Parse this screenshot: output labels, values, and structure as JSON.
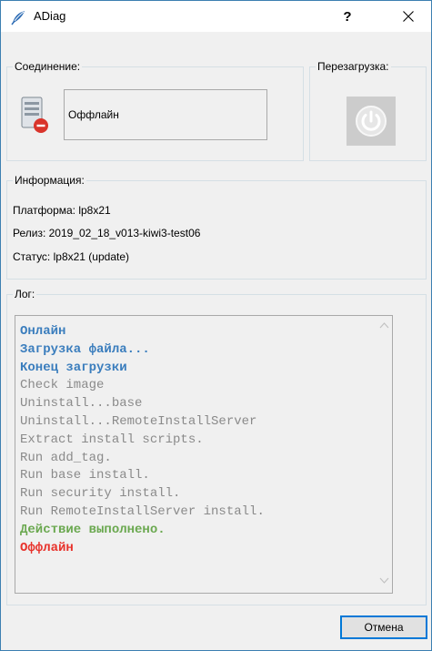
{
  "window": {
    "title": "ADiag",
    "help_label": "?",
    "close_icon": "close-icon",
    "app_icon": "app-feather-icon"
  },
  "connection": {
    "group_label": "Соединение:",
    "status": "Оффлайн",
    "status_icon": "server-offline-icon"
  },
  "reboot": {
    "group_label": "Перезагрузка:",
    "button_icon": "power-icon"
  },
  "info": {
    "group_label": "Информация:",
    "platform": "Платформа: lp8x21",
    "release": "Релиз: 2019_02_18_v013-kiwi3-test06",
    "status": "Статус: lp8x21 (update)"
  },
  "log": {
    "group_label": "Лог:",
    "lines": [
      {
        "text": "Онлайн",
        "color": "#3a7dbd",
        "bold": true
      },
      {
        "text": "Загрузка файла...",
        "color": "#3a7dbd",
        "bold": true
      },
      {
        "text": "Конец загрузки",
        "color": "#3a7dbd",
        "bold": true
      },
      {
        "text": "Check image",
        "color": "#8a8a8a",
        "bold": false
      },
      {
        "text": "Uninstall...base",
        "color": "#8a8a8a",
        "bold": false
      },
      {
        "text": "Uninstall...RemoteInstallServer",
        "color": "#8a8a8a",
        "bold": false
      },
      {
        "text": "Extract install scripts.",
        "color": "#8a8a8a",
        "bold": false
      },
      {
        "text": "Run add_tag.",
        "color": "#8a8a8a",
        "bold": false
      },
      {
        "text": "Run base install.",
        "color": "#8a8a8a",
        "bold": false
      },
      {
        "text": "Run security install.",
        "color": "#8a8a8a",
        "bold": false
      },
      {
        "text": "Run RemoteInstallServer install.",
        "color": "#8a8a8a",
        "bold": false
      },
      {
        "text": "Действие выполнено.",
        "color": "#6aa84f",
        "bold": true
      },
      {
        "text": "Оффлайн",
        "color": "#e8322b",
        "bold": true
      }
    ]
  },
  "footer": {
    "cancel_label": "Отмена"
  }
}
